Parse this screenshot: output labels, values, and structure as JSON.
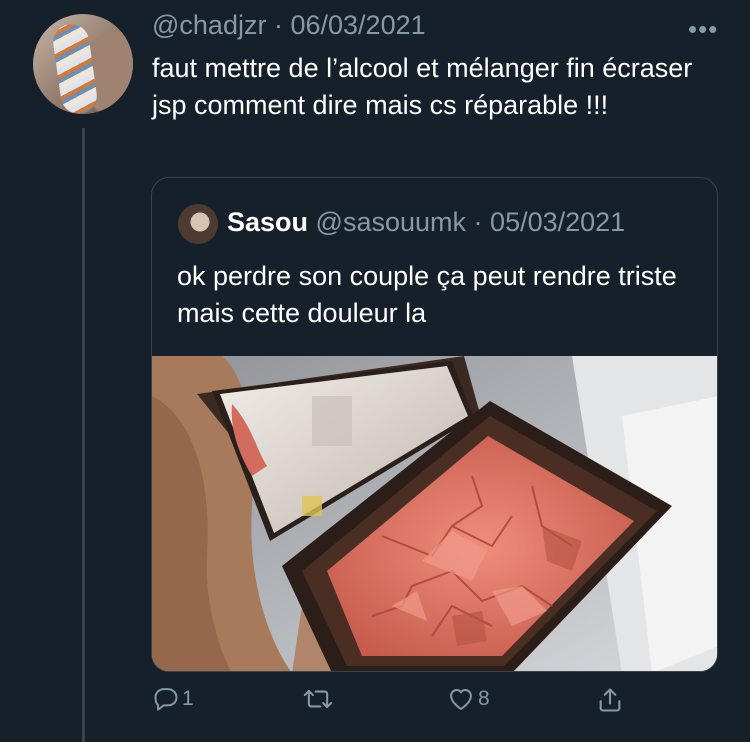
{
  "tweet": {
    "handle": "@chadjzr",
    "separator": "·",
    "date": "06/03/2021",
    "more_label": "•••",
    "text": "faut mettre de l’alcool et mélanger fin écraser jsp comment dire mais cs réparable !!!"
  },
  "quoted_tweet": {
    "name": "Sasou",
    "handle": "@sasouumk",
    "separator": "·",
    "date": "05/03/2021",
    "text": "ok perdre son couple ça peut rendre triste mais cette douleur la"
  },
  "actions": {
    "reply": {
      "icon": "reply-icon",
      "count": "1"
    },
    "retweet": {
      "icon": "retweet-icon",
      "count": ""
    },
    "like": {
      "icon": "heart-icon",
      "count": "8"
    },
    "share": {
      "icon": "share-icon"
    }
  },
  "colors": {
    "background": "#15202b",
    "secondary_text": "#8899a6",
    "border": "#38444d"
  }
}
